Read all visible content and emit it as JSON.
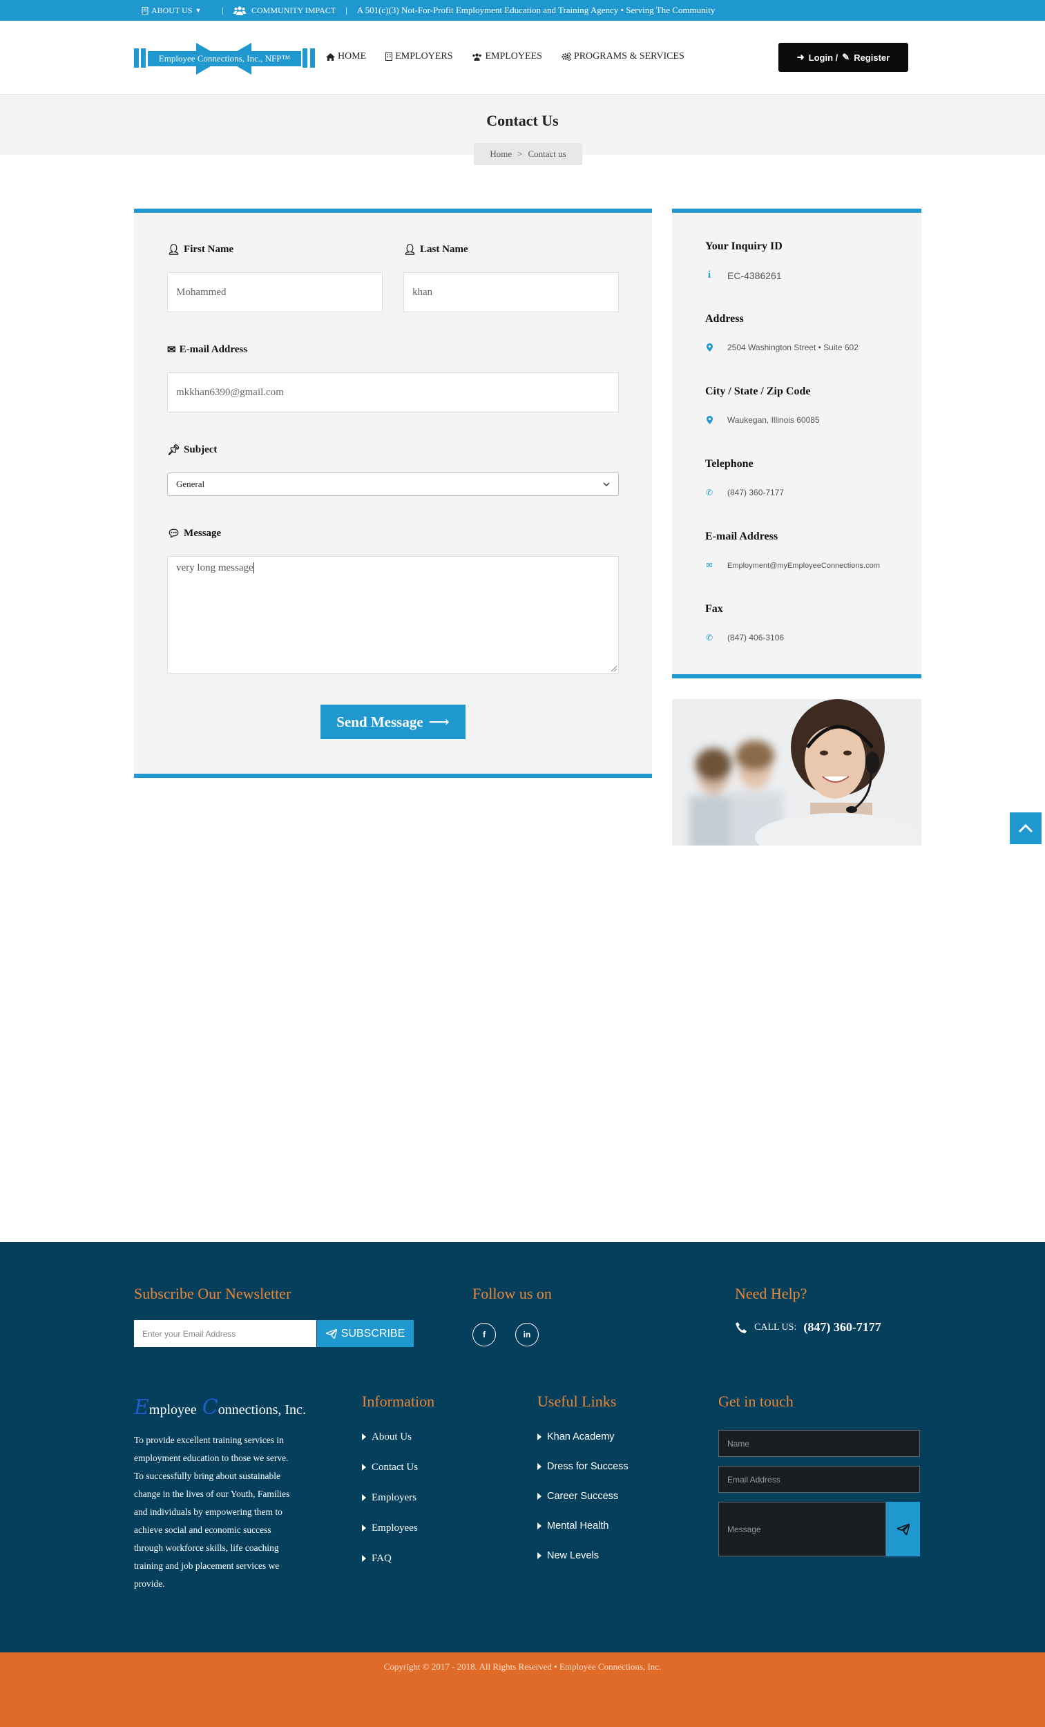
{
  "topbar": {
    "about_label": "ABOUT US",
    "community_label": "COMMUNITY IMPACT",
    "tagline": "A 501(c)(3) Not-For-Profit Employment Education and Training Agency • Serving The Community"
  },
  "header": {
    "logo_text": "Employee Connections, Inc., NFP™",
    "nav": [
      {
        "label": "HOME",
        "icon": "home-icon"
      },
      {
        "label": "EMPLOYERS",
        "icon": "building-icon"
      },
      {
        "label": "EMPLOYEES",
        "icon": "users-icon"
      },
      {
        "label": "PROGRAMS & SERVICES",
        "icon": "cogs-icon"
      }
    ],
    "login_label": "Login /",
    "register_label": "Register"
  },
  "page": {
    "title": "Contact Us",
    "breadcrumb": [
      "Home",
      ">",
      "Contact us"
    ]
  },
  "form": {
    "first_name_label": "First Name",
    "first_name_value": "Mohammed",
    "last_name_label": "Last Name",
    "last_name_value": "khan",
    "email_label": "E-mail Address",
    "email_value": "mkkhan6390@gmail.com",
    "subject_label": "Subject",
    "subject_value": "General",
    "message_label": "Message",
    "message_value": "very long message",
    "send_label": "Send Message"
  },
  "info": {
    "inquiry_label": "Your Inquiry ID",
    "inquiry_value": "EC-4386261",
    "address_label": "Address",
    "address_value": "2504 Washington Street • Suite 602",
    "city_label": "City / State / Zip Code",
    "city_value": "Waukegan, Illinois 60085",
    "phone_label": "Telephone",
    "phone_value": "(847) 360-7177",
    "email_label": "E-mail Address",
    "email_value": "Employment@myEmployeeConnections.com",
    "fax_label": "Fax",
    "fax_value": "(847) 406-3106"
  },
  "footer": {
    "newsletter_title": "Subscribe Our Newsletter",
    "newsletter_placeholder": "Enter your Email Address",
    "subscribe_label": "SUBSCRIBE",
    "follow_title": "Follow us on",
    "social": [
      "f",
      "in"
    ],
    "help_title": "Need Help?",
    "call_label": "CALL US:",
    "call_number": "(847) 360-7177",
    "brand_initial_1": "E",
    "brand_rest_1": "mployee",
    "brand_initial_2": "C",
    "brand_rest_2": "onnections, Inc.",
    "mission": "To provide excellent training services in employment education to those we serve. To successfully bring about sustainable change in the lives of our Youth, Families and individuals by empowering them to achieve social and economic success through workforce skills, life coaching training and job placement services we provide.",
    "information_title": "Information",
    "information_links": [
      "About Us",
      "Contact Us",
      "Employers",
      "Employees",
      "FAQ"
    ],
    "useful_title": "Useful Links",
    "useful_links": [
      "Khan Academy",
      "Dress for Success",
      "Career Success",
      "Mental Health",
      "New Levels"
    ],
    "touch_title": "Get in touch",
    "touch_name": "Name",
    "touch_email": "Email Address",
    "touch_message": "Message",
    "copyright": "Copyright © 2017 - 2018. All Rights Reserved • Employee Connections, Inc."
  },
  "colors": {
    "accent": "#1f97cf",
    "footer_bg": "#053f5c",
    "footer_heading": "#e98737",
    "copyright_bg": "#e06a27"
  }
}
